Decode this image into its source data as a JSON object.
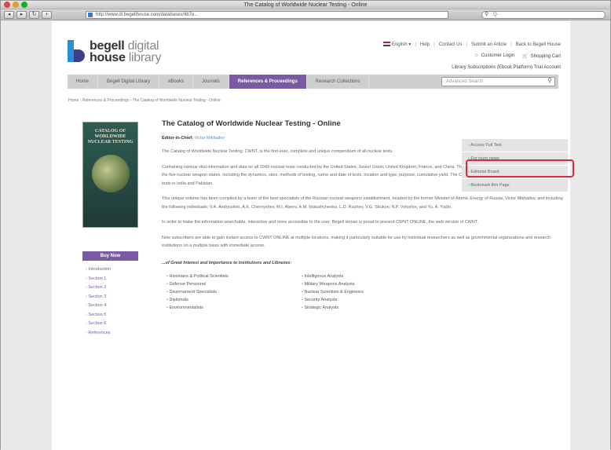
{
  "browser": {
    "window_title": "The Catalog of Worldwide Nuclear Testing - Online",
    "url": "http://www.dl.begellhouse.com/databases/4b7e...",
    "search_placeholder": "Q-",
    "nav_buttons": [
      "◂",
      "▸",
      "↻",
      "+"
    ]
  },
  "logo": {
    "line1_bold": "begell",
    "line1_light": " digital",
    "line2_bold": "house",
    "line2_light": " library"
  },
  "header": {
    "language": "English",
    "top_links": [
      "Help",
      "Contact Us",
      "Submit an Article",
      "Back to Begell House"
    ],
    "customer_login": "Customer Login",
    "shopping_cart": "Shopping Cart",
    "subscription_links": "Library Subscriptions (Ebook Platform) Trial Account"
  },
  "navbar": {
    "items": [
      "Home",
      "Begell Digital Library",
      "eBooks",
      "Journals",
      "References & Proceedings",
      "Research Collections"
    ],
    "active_index": 4,
    "search_placeholder": "Advanced Search"
  },
  "breadcrumb": "Home › References & Proceedings › The Catalog of Worldwide Nuclear Testing - Online",
  "book": {
    "cover_title": "CATALOG OF WORLDWIDE NUCLEAR TESTING",
    "buy_now": "Buy Now",
    "toc": [
      "Introduction",
      "Section 1",
      "Section 2",
      "Section 3",
      "Section 4",
      "Section 5",
      "Section 6",
      "References"
    ]
  },
  "main": {
    "title": "The Catalog of Worldwide Nuclear Testing - Online",
    "editor_label": "Editor-in-Chief:",
    "editor_name": "Victor Mikhailov",
    "para1": "The Catalog of Worldwide Nuclear Testing: CWNT, is the first-ever, complete and unique compendium of all nuclear tests.",
    "para2": "Containing various vital information and data on all 2049 nuclear tests conducted by the United States, Soviet Union, United Kingdom, France, and China. The Catalog presents a uniform classification analysis of the five nuclear weapon states, including the dynamics, sites, methods of testing, name and date of tests, location and type, purpose, cumulative yield. The Catalog also includes information on the desert nuclear tests in India and Pakistan.",
    "para3": "This unique volume has been compiled by a team of the best specialists of the Russian nuclear weapons establishment, headed by the former Minister of Atomic Energy of Russia, Victor Mikhailov, and including the following individuals: V.A. Andryushin, A.K. Chernyshev, M.I. Abeev, A.M. Matushchenko, L.D. Rozhev, V.G. Strukov, N.P. Voloshin, and Yu. A. Yudin.",
    "para4": "In order to make the information searchable, interactive and more accessible to the user, Begell House is proud to present CWNT ONLINE, the web version of CWNT.",
    "para5": "Now subscribers are able to gain instant access to CWNT ONLINE at multiple locations, making it particularly suitable for use by individual researchers as well as governmental organizations and research institutions on a multiple basis with immediate access.",
    "subhead": "...of Great Interest and Importance to Institutions and Libraries:",
    "list_left": [
      "Historians & Political Scientists",
      "Defense Personnel",
      "Disarmament Specialists",
      "Diplomats",
      "Environmentalists"
    ],
    "list_right": [
      "Intelligence Analysts",
      "Military Weapons Analysts",
      "Nuclear Scientists & Engineers",
      "Security Analysts",
      "Strategic Analysts"
    ]
  },
  "side_menu": {
    "items": [
      "Access Full Text",
      "For journ news",
      "Editorial Board",
      "Bookmark this Page"
    ],
    "highlighted_index": 0,
    "highlight_color": "#d42a44"
  },
  "colors": {
    "accent_purple": "#7a5aa3",
    "nav_bg": "#cfcfcf",
    "logo_blue": "#2b8fd3"
  }
}
